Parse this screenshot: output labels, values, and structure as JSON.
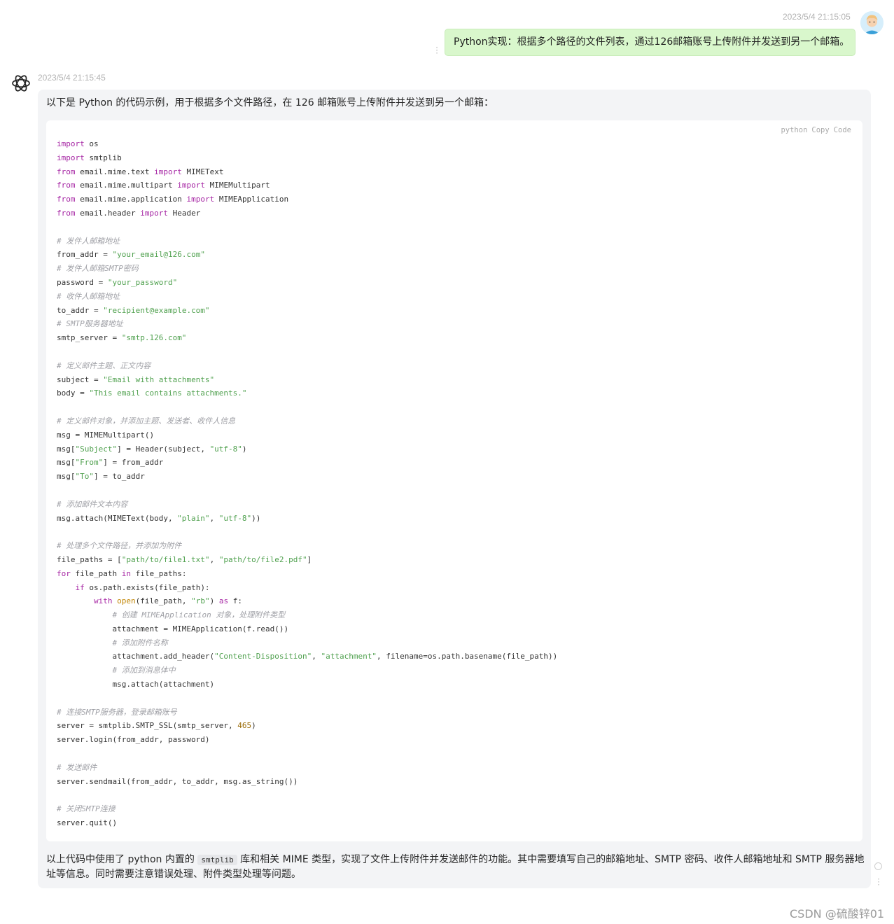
{
  "user_message": {
    "timestamp": "2023/5/4 21:15:05",
    "text": "Python实现：根据多个路径的文件列表，通过126邮箱账号上传附件并发送到另一个邮箱。"
  },
  "assistant_message": {
    "timestamp": "2023/5/4 21:15:45",
    "intro": "以下是 Python 的代码示例，用于根据多个文件路径，在 126 邮箱账号上传附件并发送到另一个邮箱：",
    "code_block": {
      "language": "python",
      "copy_label": "Copy",
      "code_label": "Code"
    },
    "summary_before": "以上代码中使用了 python 内置的 ",
    "summary_inline_code": "smtplib",
    "summary_after": " 库和相关 MIME 类型，实现了文件上传附件并发送邮件的功能。其中需要填写自己的邮箱地址、SMTP 密码、收件人邮箱地址和 SMTP 服务器地址等信息。同时需要注意错误处理、附件类型处理等问题。"
  },
  "watermark": "CSDN @硫酸锌01",
  "icons": [
    "user-avatar-icon",
    "openai-logo-icon",
    "more-dots-icon",
    "circle-icon"
  ],
  "colors": {
    "user_bubble": "#d9f7cc",
    "assistant_card": "#f3f4f6",
    "keyword": "#a626a4",
    "string": "#50a14f",
    "comment": "#a0a1a7"
  }
}
